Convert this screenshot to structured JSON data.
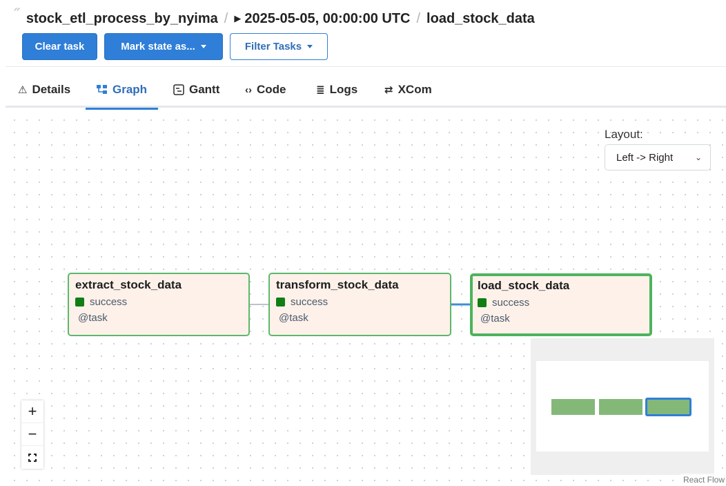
{
  "breadcrumb": {
    "dag_id": "stock_etl_process_by_nyima",
    "run": "2025-05-05, 00:00:00 UTC",
    "task_id": "load_stock_data"
  },
  "actions": {
    "clear_label": "Clear task",
    "mark_state_label": "Mark state as...",
    "filter_label": "Filter Tasks"
  },
  "tabs": [
    {
      "label": "Details",
      "icon": "warning-triangle-icon"
    },
    {
      "label": "Graph",
      "icon": "graph-icon",
      "active": true
    },
    {
      "label": "Gantt",
      "icon": "gantt-icon"
    },
    {
      "label": "Code",
      "icon": "code-icon"
    },
    {
      "label": "Logs",
      "icon": "logs-icon"
    },
    {
      "label": "XCom",
      "icon": "xcom-icon"
    }
  ],
  "graph": {
    "layout_label": "Layout:",
    "layout_value": "Left -> Right",
    "nodes": [
      {
        "id": "extract_stock_data",
        "state": "success",
        "decorator": "@task"
      },
      {
        "id": "transform_stock_data",
        "state": "success",
        "decorator": "@task"
      },
      {
        "id": "load_stock_data",
        "state": "success",
        "decorator": "@task",
        "selected": true
      }
    ],
    "colors": {
      "success": "#117e14",
      "node_border": "#5cb86b",
      "node_fill": "#fdf1ea",
      "edge": "#b8c4cc",
      "selected_edge": "#3b8fd8",
      "accent": "#2f7ed8"
    },
    "attribution": "React Flow"
  },
  "controls": {
    "zoom_in": "+",
    "zoom_out": "−"
  }
}
